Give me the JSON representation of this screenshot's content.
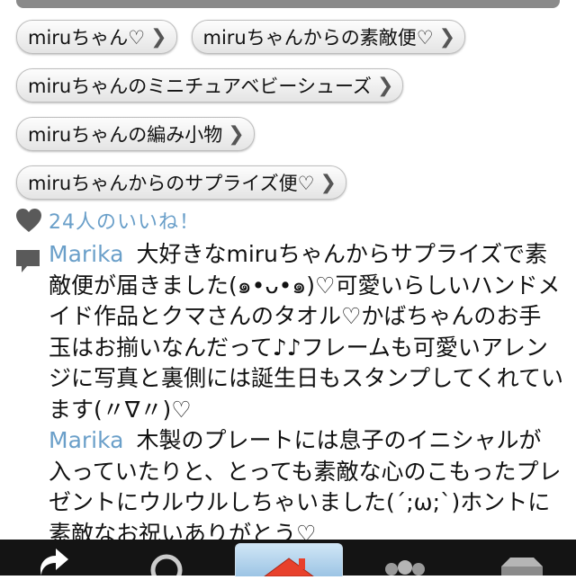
{
  "tags": [
    [
      "miruちゃん♡",
      "miruちゃんからの素敵便♡"
    ],
    [
      "miruちゃんのミニチュアベビーシューズ"
    ],
    [
      "miruちゃんの編み小物"
    ],
    [
      "miruちゃんからのサプライズ便♡"
    ]
  ],
  "likes": {
    "text": "24人のいいね！"
  },
  "comments": [
    {
      "author": "Marika",
      "text": "大好きなmiruちゃんからサプライズで素敵便が届きました(๑•ᴗ•๑)♡可愛いらしいハンドメイド作品とクマさんのタオル♡かばちゃんのお手玉はお揃いなんだって♪♪フレームも可愛いアレンジに写真と裏側には誕生日もスタンプしてくれています(〃∇〃)♡"
    },
    {
      "author": "Marika",
      "text": "木製のプレートには息子のイニシャルが入っていたりと、とっても素敵な心のこもったプレゼントにウルウルしちゃいました(´;ω;`)ホントに素敵なお祝いありがとう♡"
    }
  ],
  "tabbar": {
    "tabs": [
      {
        "icon": "share-arrow-icon"
      },
      {
        "icon": "search-icon"
      },
      {
        "icon": "home-icon",
        "active": true
      },
      {
        "icon": "people-icon"
      },
      {
        "icon": "inbox-icon"
      }
    ]
  },
  "colors": {
    "link": "#6a9fc9",
    "tabbar": "#141414",
    "active_tab": "#9cc4e4",
    "home_roof": "#e8412c"
  }
}
